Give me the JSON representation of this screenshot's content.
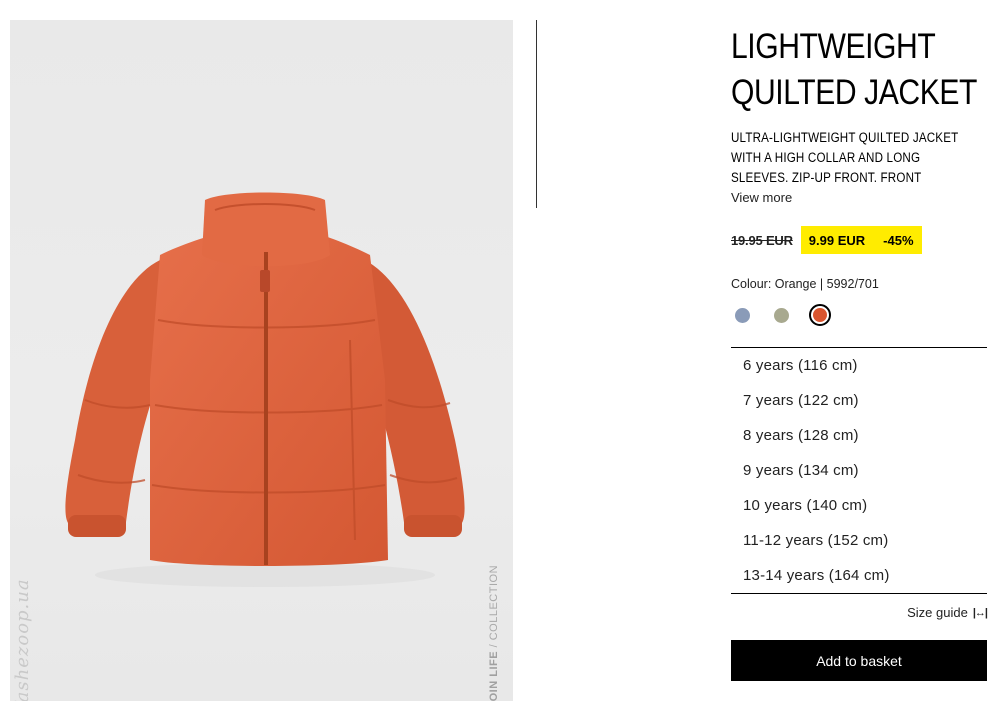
{
  "product": {
    "title_line1": "LIGHTWEIGHT",
    "title_line2": "QUILTED JACKET",
    "description_line1": "ULTRA-LIGHTWEIGHT QUILTED JACKET",
    "description_line2": "WITH A HIGH COLLAR AND LONG",
    "description_line3": "SLEEVES. ZIP-UP FRONT. FRONT",
    "view_more": "View more",
    "old_price": "19.95 EUR",
    "sale_price": "9.99 EUR",
    "discount": "-45%",
    "colour_info": "Colour: Orange | 5992/701"
  },
  "image": {
    "side_label_bold": "JOIN LIFE",
    "side_label_rest": " / COLLECTION",
    "watermark": "fashezoop.ua",
    "jacket_color": "#e0643f"
  },
  "colors": {
    "accent_yellow": "#ffec00",
    "swatch_blue": "#8a9bb8",
    "swatch_khaki": "#a8a98f",
    "swatch_orange": "#d9542e"
  },
  "sizes": [
    "6 years (116 cm)",
    "7 years (122 cm)",
    "8 years (128 cm)",
    "9 years (134 cm)",
    "10 years (140 cm)",
    "11-12 years (152 cm)",
    "13-14 years (164 cm)"
  ],
  "actions": {
    "size_guide": "Size guide",
    "add_to_basket": "Add to basket"
  }
}
